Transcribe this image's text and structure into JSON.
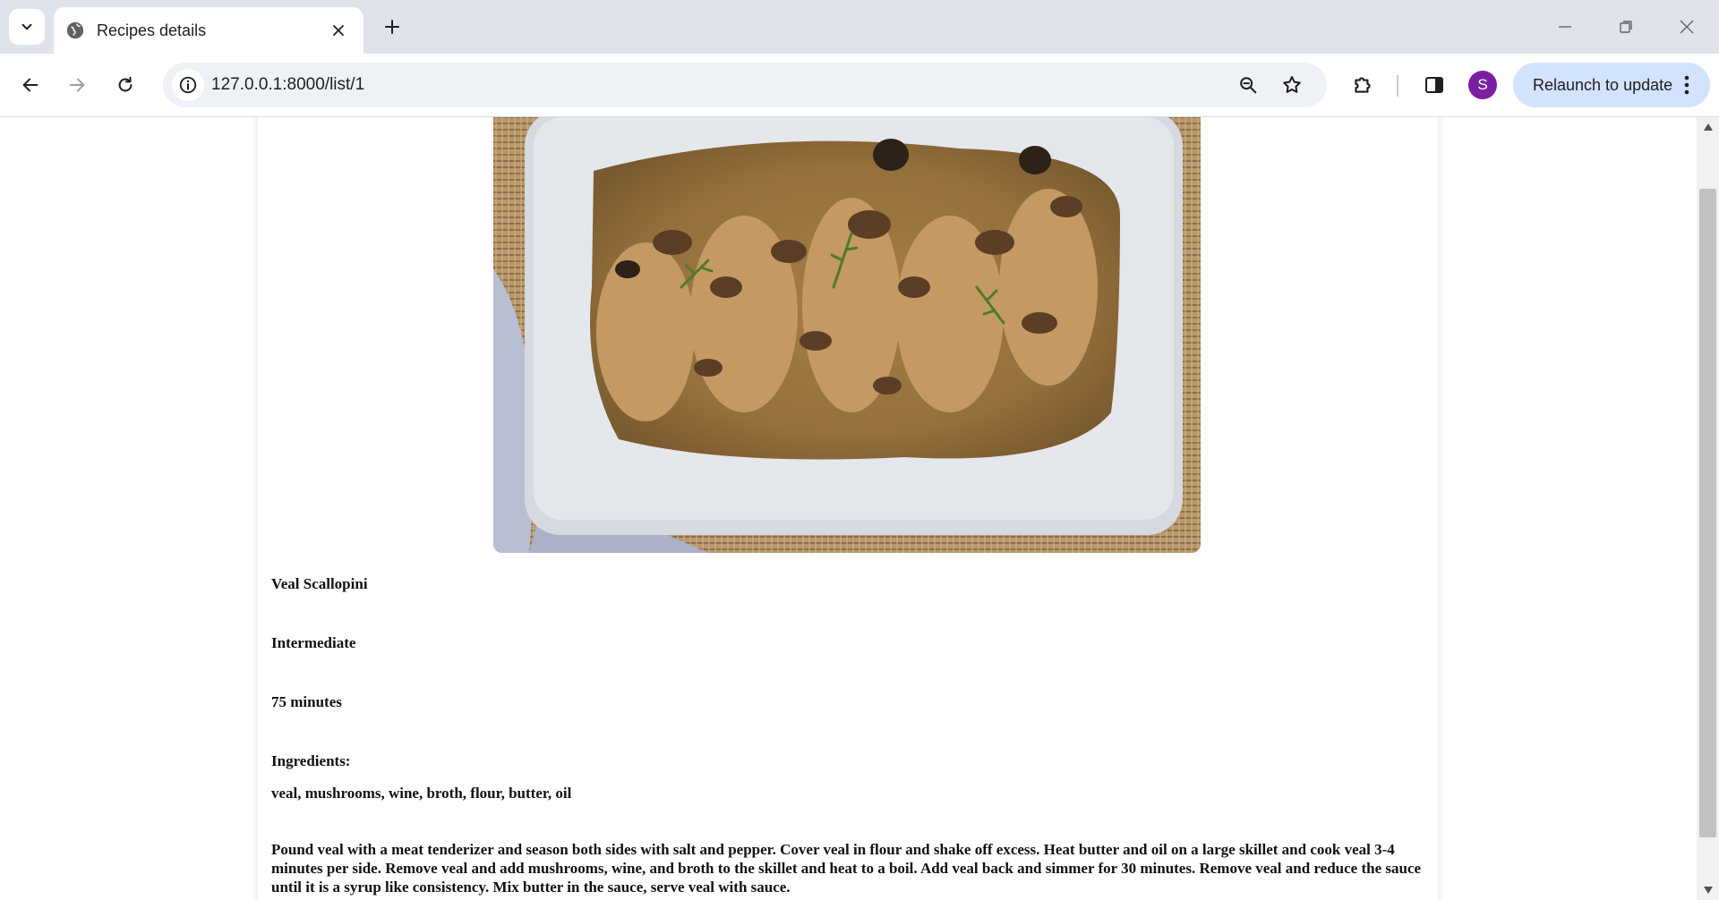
{
  "browser": {
    "tab_title": "Recipes details",
    "url": "127.0.0.1:8000/list/1",
    "profile_initial": "S",
    "relaunch_label": "Relaunch to update"
  },
  "recipe": {
    "name": "Veal Scallopini",
    "difficulty": "Intermediate",
    "time": "75 minutes",
    "ingredients_label": "Ingredients:",
    "ingredients": "veal, mushrooms, wine, broth, flour, butter, oil",
    "instructions": "Pound veal with a meat tenderizer and season both sides with salt and pepper. Cover veal in flour and shake off excess. Heat butter and oil on a large skillet and cook veal 3-4 minutes per side. Remove veal and add mushrooms, wine, and broth to the skillet and heat to a boil. Add veal back and simmer for 30 minutes. Remove veal and reduce the sauce until it is a syrup like consistency. Mix butter in the sauce, serve veal with sauce."
  },
  "icons": {
    "tab_search": "chevron-down-icon",
    "favicon": "globe-icon",
    "tab_close": "close-icon",
    "new_tab": "plus-icon",
    "back": "arrow-left-icon",
    "forward": "arrow-right-icon",
    "reload": "reload-icon",
    "site_info": "info-icon",
    "zoom": "zoom-icon",
    "bookmark": "star-icon",
    "extensions": "puzzle-icon",
    "side_panel": "side-panel-icon",
    "menu": "kebab-menu-icon"
  },
  "colors": {
    "tabstrip": "#dfe3ea",
    "omnibox": "#eef1f6",
    "relaunch_button": "#d3e3fd",
    "avatar": "#7b1fa2"
  }
}
